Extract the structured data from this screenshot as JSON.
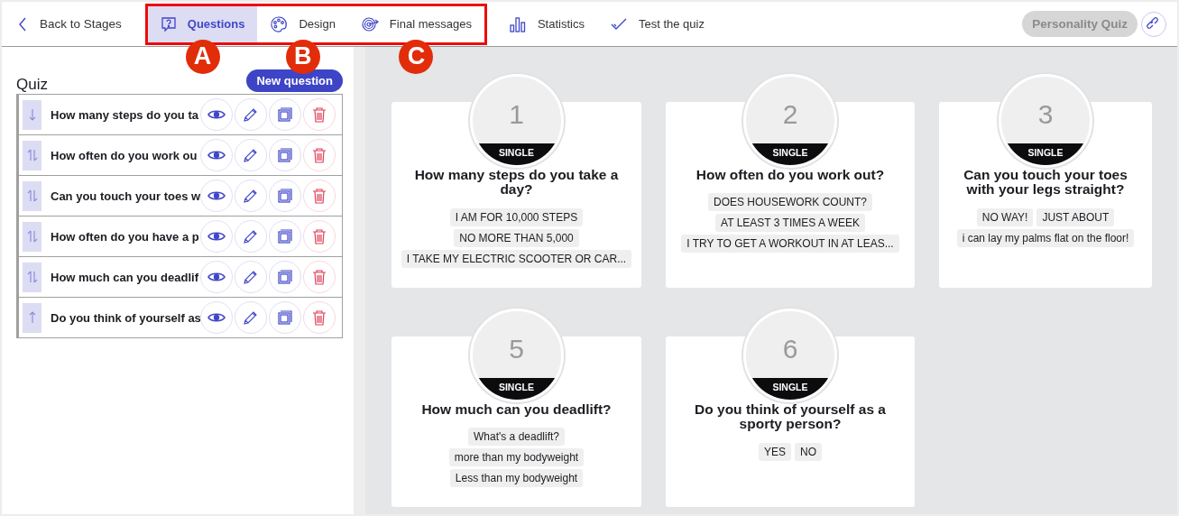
{
  "topbar": {
    "back": "Back to Stages",
    "tabs": [
      {
        "label": "Questions",
        "selected": true,
        "callout": "A"
      },
      {
        "label": "Design",
        "selected": false,
        "callout": "B"
      },
      {
        "label": "Final messages",
        "selected": false,
        "callout": "C"
      },
      {
        "label": "Statistics",
        "selected": false
      },
      {
        "label": "Test the quiz",
        "selected": false
      }
    ],
    "quiz_name": "Personality Quiz"
  },
  "sidebar": {
    "title": "Quiz",
    "new_button": "New question",
    "items": [
      {
        "text": "How many steps do you ta",
        "kind": "down"
      },
      {
        "text": "How often do you work ou",
        "kind": "both"
      },
      {
        "text": "Can you touch your toes w",
        "kind": "both"
      },
      {
        "text": "How often do you have a p",
        "kind": "both"
      },
      {
        "text": "How much can you deadlif",
        "kind": "both"
      },
      {
        "text": "Do you think of yourself as",
        "kind": "up"
      }
    ]
  },
  "cards": [
    {
      "number": "1",
      "type": "SINGLE",
      "question": "How many steps do you take a day?",
      "answers": [
        "I AM FOR 10,000 STEPS",
        "NO MORE THAN 5,000",
        "I TAKE MY ELECTRIC SCOOTER OR CAR..."
      ]
    },
    {
      "number": "2",
      "type": "SINGLE",
      "question": "How often do you work out?",
      "answers": [
        "DOES HOUSEWORK COUNT?",
        "AT LEAST 3 TIMES A WEEK",
        "I TRY TO GET A WORKOUT IN AT LEAS..."
      ]
    },
    {
      "number": "3",
      "type": "SINGLE",
      "question": "Can you touch your toes with your legs straight?",
      "answers": [
        "NO WAY!",
        "JUST ABOUT",
        "i can lay my palms flat on the floor!"
      ]
    },
    {
      "number": "5",
      "type": "SINGLE",
      "question": "How much can you deadlift?",
      "answers": [
        "What's a deadlift?",
        "more than my bodyweight",
        "Less than my bodyweight"
      ]
    },
    {
      "number": "6",
      "type": "SINGLE",
      "question": "Do you think of yourself as a sporty person?",
      "answers": [
        "YES",
        "NO"
      ]
    }
  ]
}
